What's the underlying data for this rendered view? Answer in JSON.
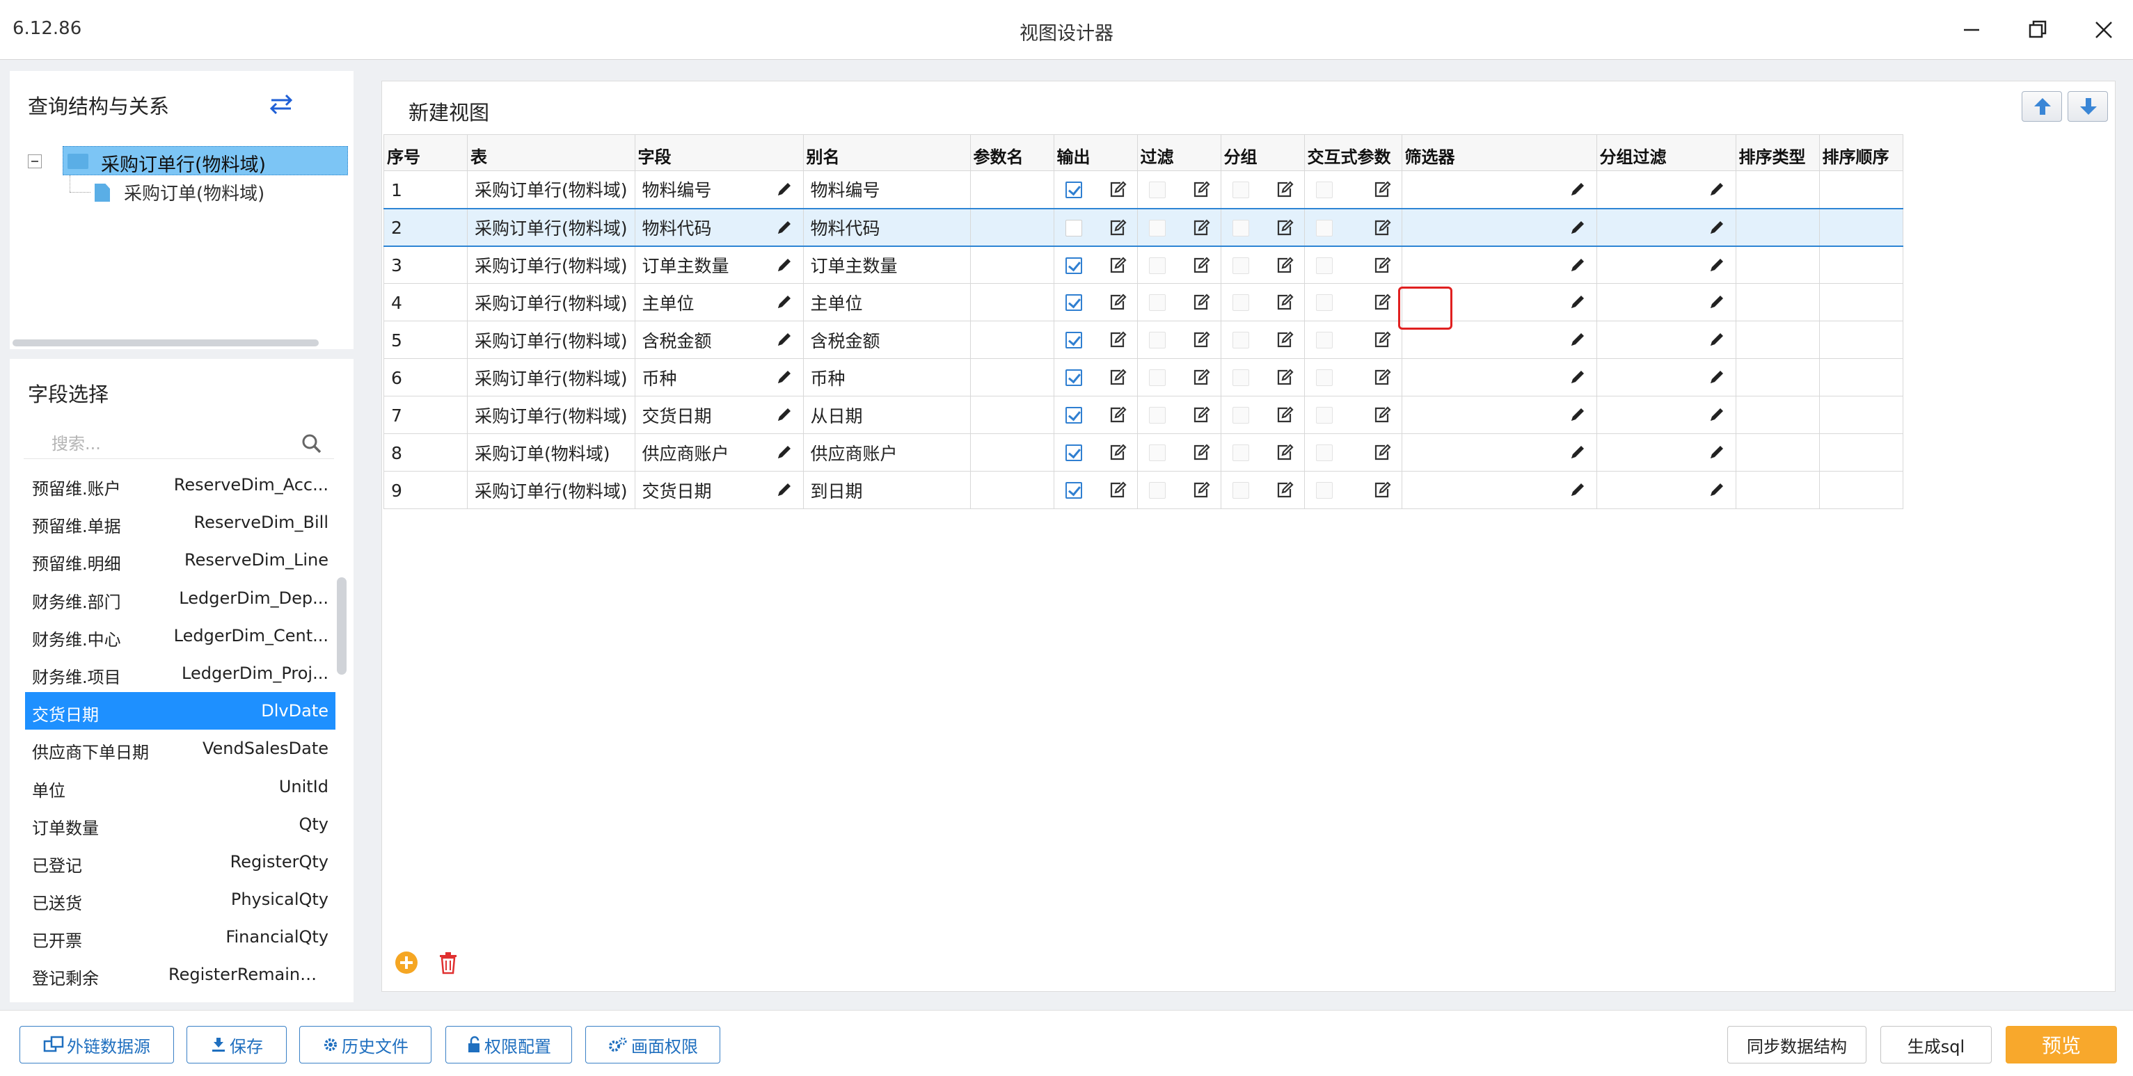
{
  "window": {
    "version": "6.12.86",
    "title": "视图设计器"
  },
  "tree_panel": {
    "title": "查询结构与关系",
    "root_label": "采购订单行(物料域)",
    "child_label": "采购订单(物料域)"
  },
  "fields_panel": {
    "title": "字段选择",
    "search_placeholder": "搜索...",
    "items": [
      {
        "label": "预留维.账户",
        "field": "ReserveDim_Acc..."
      },
      {
        "label": "预留维.单据",
        "field": "ReserveDim_Bill"
      },
      {
        "label": "预留维.明细",
        "field": "ReserveDim_Line"
      },
      {
        "label": "财务维.部门",
        "field": "LedgerDim_Dep..."
      },
      {
        "label": "财务维.中心",
        "field": "LedgerDim_Cent..."
      },
      {
        "label": "财务维.项目",
        "field": "LedgerDim_Proj..."
      },
      {
        "label": "交货日期",
        "field": "DlvDate"
      },
      {
        "label": "供应商下单日期",
        "field": "VendSalesDate"
      },
      {
        "label": "单位",
        "field": "UnitId"
      },
      {
        "label": "订单数量",
        "field": "Qty"
      },
      {
        "label": "已登记",
        "field": "RegisterQty"
      },
      {
        "label": "已送货",
        "field": "PhysicalQty"
      },
      {
        "label": "已开票",
        "field": "FinancialQty"
      },
      {
        "label": "登记剩余",
        "field": "RegisterRemainQty"
      }
    ],
    "selected_index": 6
  },
  "main": {
    "title": "新建视图",
    "columns": [
      "序号",
      "表",
      "字段",
      "别名",
      "参数名",
      "输出",
      "过滤",
      "分组",
      "交互式参数",
      "筛选器",
      "分组过滤",
      "排序类型",
      "排序顺序"
    ],
    "rows": [
      {
        "no": "1",
        "table": "采购订单行(物料域)",
        "field": "物料编号",
        "alias": "物料编号",
        "output": true
      },
      {
        "no": "2",
        "table": "采购订单行(物料域)",
        "field": "物料代码",
        "alias": "物料代码",
        "output": false
      },
      {
        "no": "3",
        "table": "采购订单行(物料域)",
        "field": "订单主数量",
        "alias": "订单主数量",
        "output": true
      },
      {
        "no": "4",
        "table": "采购订单行(物料域)",
        "field": "主单位",
        "alias": "主单位",
        "output": true
      },
      {
        "no": "5",
        "table": "采购订单行(物料域)",
        "field": "含税金额",
        "alias": "含税金额",
        "output": true
      },
      {
        "no": "6",
        "table": "采购订单行(物料域)",
        "field": "币种",
        "alias": "币种",
        "output": true
      },
      {
        "no": "7",
        "table": "采购订单行(物料域)",
        "field": "交货日期",
        "alias": "从日期",
        "output": true
      },
      {
        "no": "8",
        "table": "采购订单(物料域)",
        "field": "供应商账户",
        "alias": "供应商账户",
        "output": true
      },
      {
        "no": "9",
        "table": "采购订单行(物料域)",
        "field": "交货日期",
        "alias": "到日期",
        "output": true
      }
    ],
    "selected_row": 1
  },
  "footer": {
    "external_source": "外链数据源",
    "save": "保存",
    "history": "历史文件",
    "permission_config": "权限配置",
    "screen_permission": "画面权限",
    "sync_structure": "同步数据结构",
    "generate_sql": "生成sql",
    "preview": "预览"
  },
  "colors": {
    "accent": "#1e90ff",
    "tree_selection": "#7cc5f5",
    "checkbox": "#2f7fd1",
    "preview_button": "#f8a82c",
    "add_icon": "#f5a623",
    "delete_icon": "#e03030",
    "highlight": "#e02020"
  }
}
